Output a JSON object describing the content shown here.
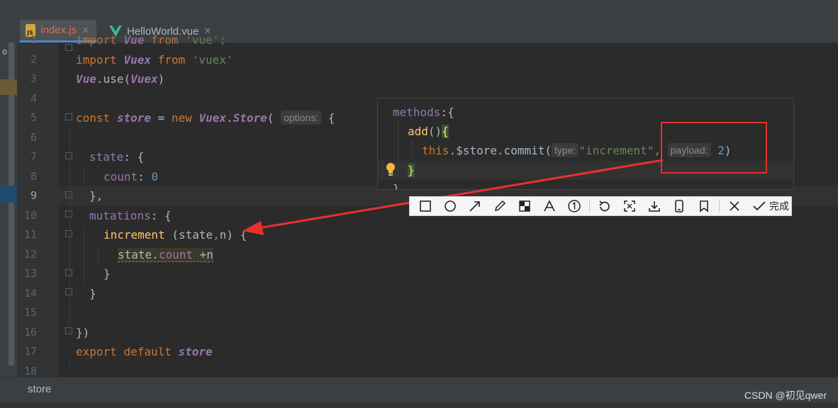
{
  "tabs": [
    {
      "label": "index.js",
      "icon": "js-file-icon",
      "active": true
    },
    {
      "label": "HelloWorld.vue",
      "icon": "vue-file-icon",
      "active": false
    }
  ],
  "left_panel": {
    "glyph": "o"
  },
  "lines": {
    "1": "1",
    "2": "2",
    "3": "3",
    "4": "4",
    "5": "5",
    "6": "6",
    "7": "7",
    "8": "8",
    "9": "9",
    "10": "10",
    "11": "11",
    "12": "12",
    "13": "13",
    "14": "14",
    "15": "15",
    "16": "16",
    "17": "17",
    "18": "18"
  },
  "current_line": 9,
  "code": {
    "l1": {
      "kw": "import",
      "cls": "Vue",
      "from": "from",
      "str": "'vue';"
    },
    "l2": {
      "kw": "import",
      "cls": "Vuex",
      "from": "from",
      "str": "'vuex'"
    },
    "l3": {
      "a": "Vue",
      "b": ".use(",
      "c": "Vuex",
      "d": ")"
    },
    "l5": {
      "kw": "const",
      "var": "store",
      "eq": " = ",
      "new": "new",
      "cls": "Vuex",
      "dot": ".",
      "cls2": "Store",
      "paren": "(",
      "hint": "options:",
      "brace": " {"
    },
    "l7": {
      "prop": "state",
      "rest": ": {"
    },
    "l8": {
      "prop": "count",
      "colon": ": ",
      "num": "0"
    },
    "l9": {
      "close": "},"
    },
    "l10": {
      "prop": "mutations",
      "rest": ": {"
    },
    "l11": {
      "fn": "increment",
      "rest": " (state",
      "comma": ",",
      "n": "n) {"
    },
    "l12": {
      "obj": "state",
      "dot": ".",
      "prop": "count",
      "rest": " +n"
    },
    "l13": {
      "close": "}"
    },
    "l14": {
      "close": "}"
    },
    "l16": {
      "close": "})"
    },
    "l17": {
      "kw": "export",
      "def": "default",
      "var": "store"
    }
  },
  "popup": {
    "p1": {
      "prop": "methods",
      "rest": ":{"
    },
    "p2": {
      "fn": "add",
      "paren": "()",
      "brace": "{"
    },
    "p3": {
      "kw": "this",
      "rest": ".$store.commit(",
      "hint_type": "type:",
      "str": "\"increment\"",
      "comma": ",",
      "hint_payload": "payload:",
      "num": "2",
      "close": ")"
    },
    "p4": {
      "brace": "}"
    },
    "p5": {
      "brace": "}"
    }
  },
  "toolbar": {
    "done_label": "完成"
  },
  "status": {
    "breadcrumb": "store"
  },
  "watermark": "CSDN @初见qwer",
  "colors": {
    "annotation_red": "#e8312f",
    "keyword": "#cc7832",
    "string": "#6a8759",
    "number": "#6897bb",
    "purple": "#9876aa",
    "function": "#ffc66d"
  }
}
